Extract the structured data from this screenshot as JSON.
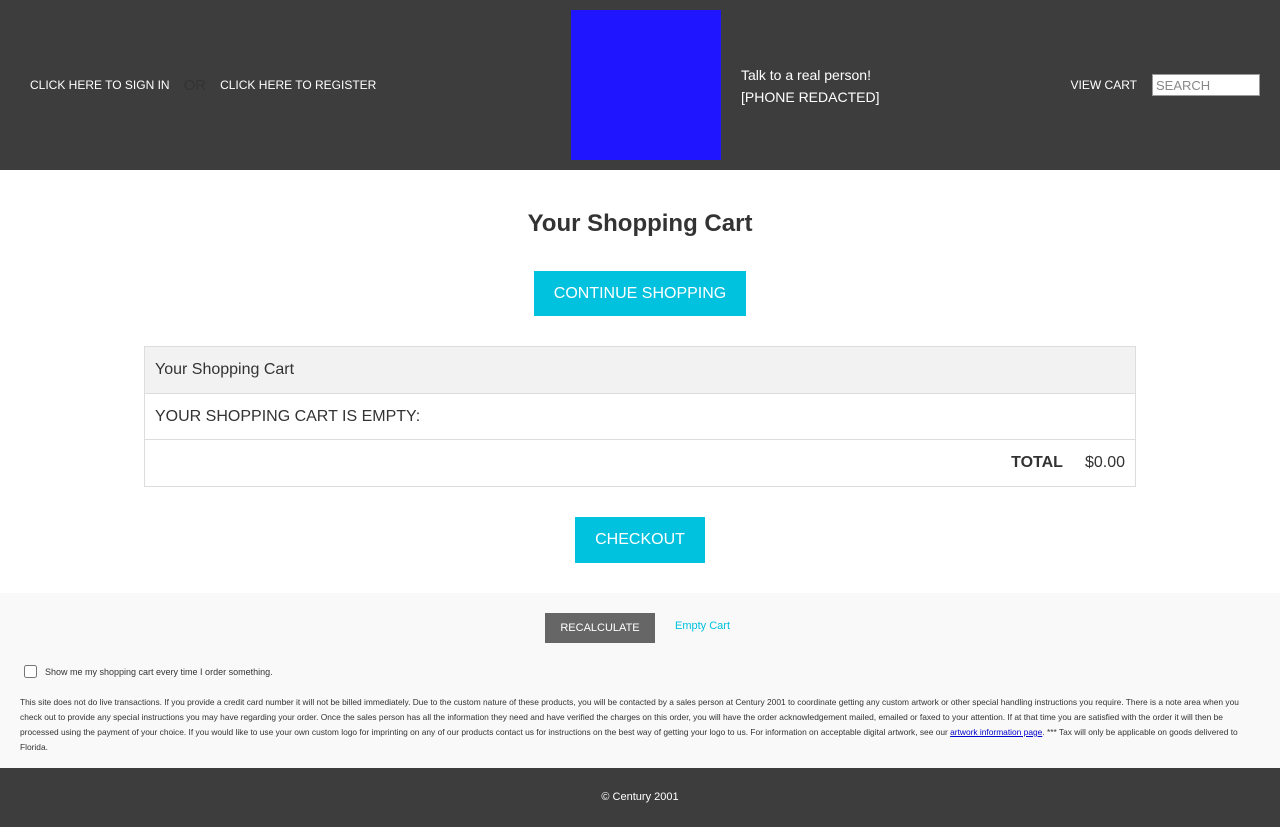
{
  "header": {
    "sign_in": "CLICK HERE TO SIGN IN",
    "or": "OR",
    "register": "CLICK HERE TO REGISTER",
    "contact_line1": "Talk to a real person!",
    "contact_line2": "[PHONE REDACTED]",
    "view_cart": "VIEW CART",
    "search_placeholder": "SEARCH",
    "logo_color": "#1f16ff"
  },
  "main": {
    "title": "Your Shopping Cart",
    "continue_button": "CONTINUE SHOPPING",
    "table": {
      "header": "Your Shopping Cart",
      "empty_message": "YOUR SHOPPING CART IS EMPTY:",
      "total_label": "TOTAL",
      "total_value": "$0.00"
    },
    "checkout_button": "CHECKOUT"
  },
  "footer": {
    "recalculate": "RECALCULATE",
    "empty_cart": "Empty Cart",
    "show_cart_label": "Show me my shopping cart every time I order something.",
    "disclaimer_part1": "This site does not do live transactions. If you provide a credit card number it will not be billed immediately. Due to the custom nature of these products, you will be contacted by a sales person at Century 2001 to coordinate getting any custom artwork or other special handling instructions you require. There is a note area when you check out to provide any special instructions you may have regarding your order. Once the sales person has all the information they need and have verified the charges on this order, you will have the order acknowledgement mailed, emailed or faxed to your attention. If at that time you are satisfied with the order it will then be processed using the payment of your choice. If you would like to use your own custom logo for imprinting on any of our products contact us for instructions on the best way of getting your logo to us. For information on acceptable digital artwork, see our ",
    "disclaimer_link": "artwork information page",
    "disclaimer_part2": ". *** Tax will only be applicable on goods delivered to Florida.",
    "copyright": "© Century 2001"
  },
  "colors": {
    "header_bg": "#3d3d3d",
    "accent": "#00c1de",
    "recalc_bg": "#666666"
  }
}
